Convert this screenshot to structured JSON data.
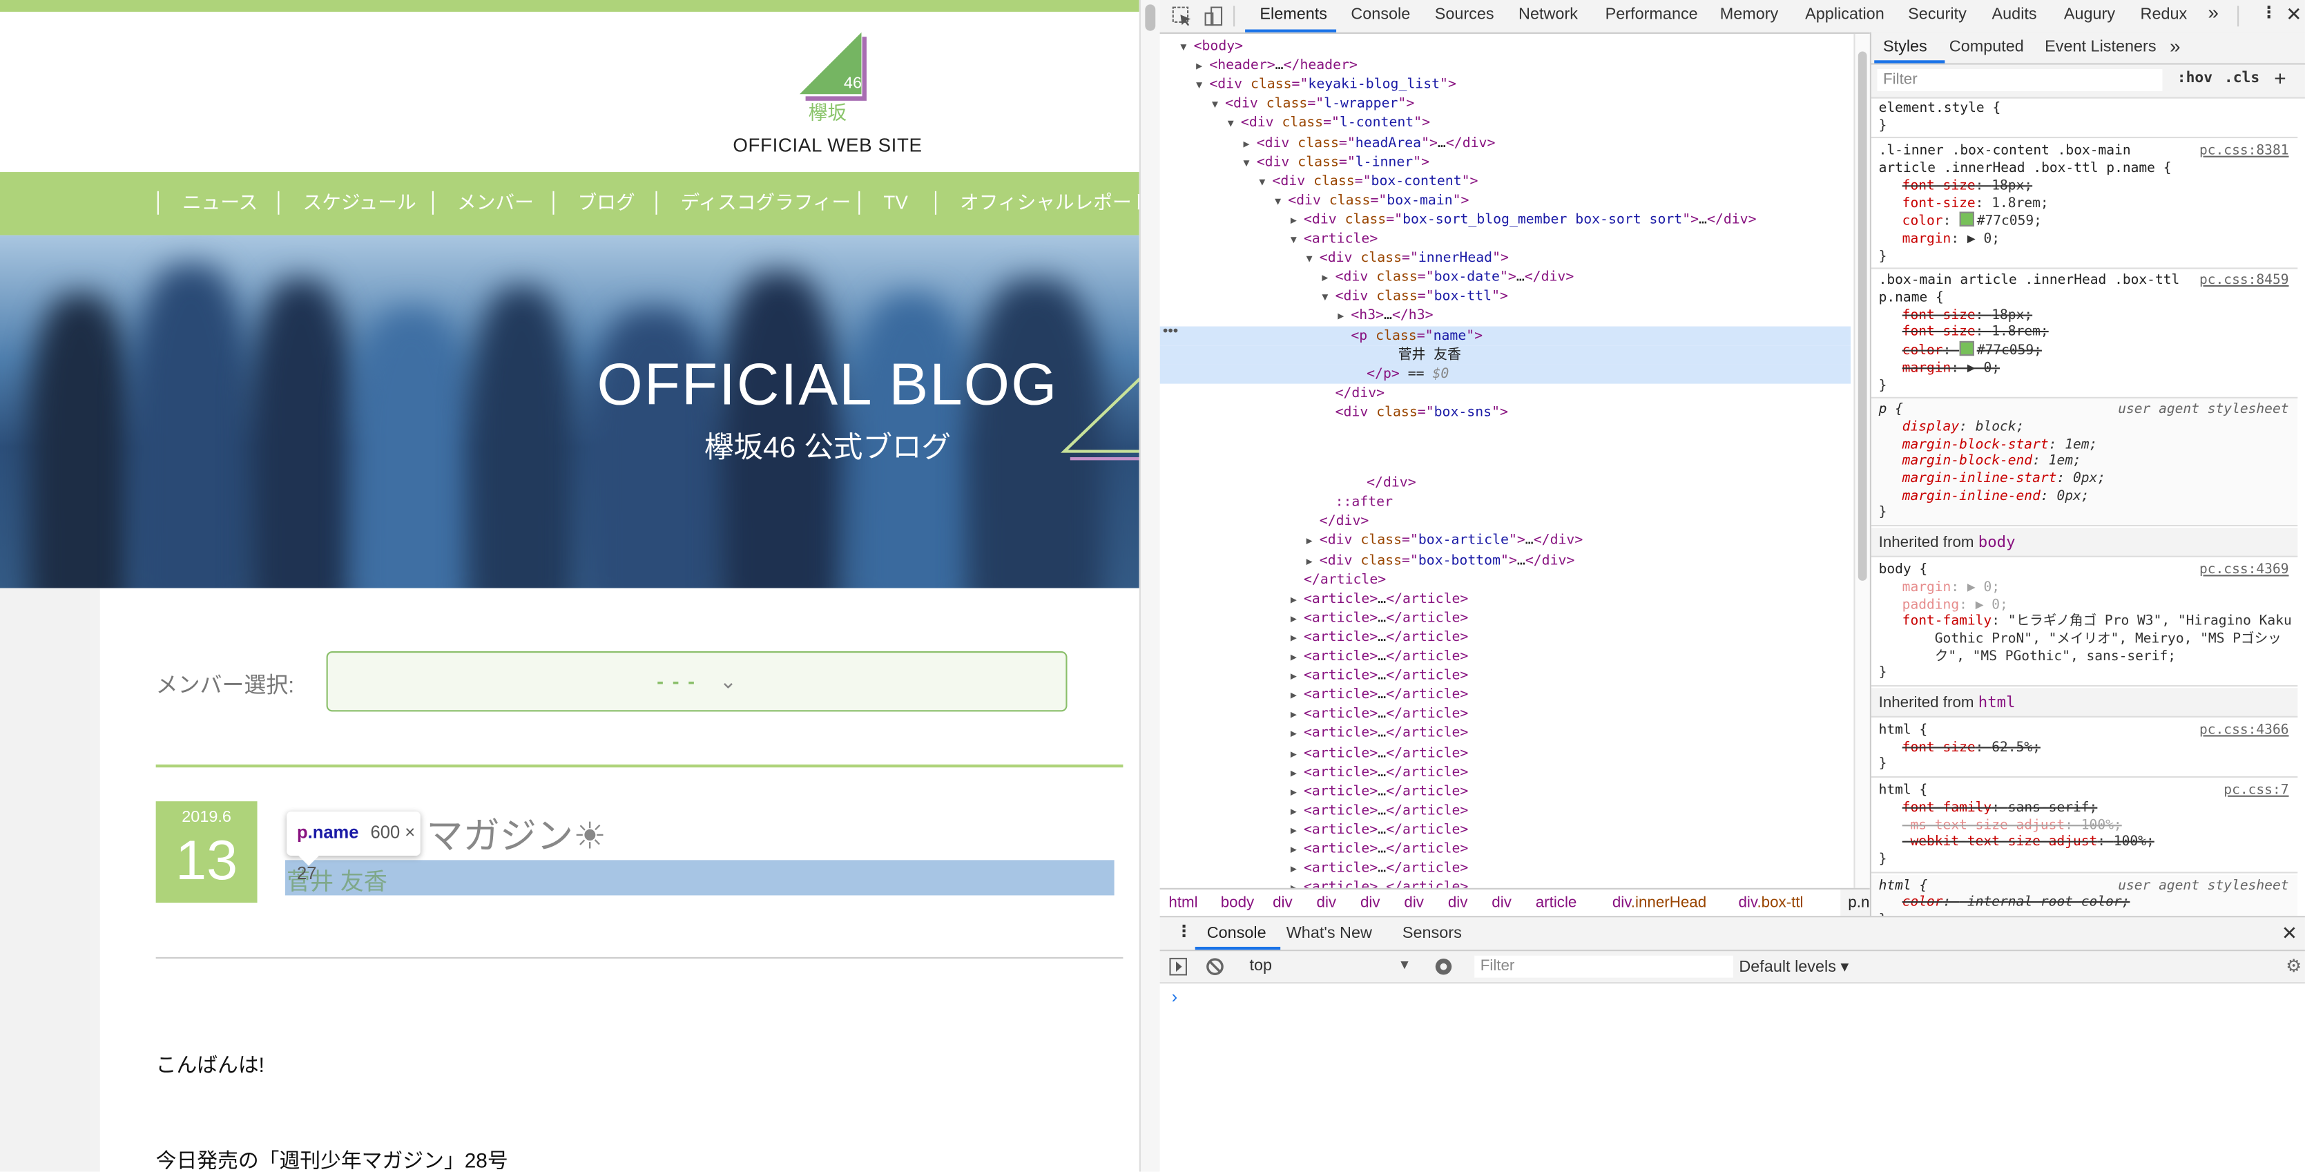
{
  "page": {
    "logo": {
      "number": "46",
      "name": "欅坂"
    },
    "site_title": "OFFICIAL WEB SITE",
    "nav": [
      "ニュース",
      "スケジュール",
      "メンバー",
      "ブログ",
      "ディスコグラフィー",
      "TV",
      "オフィシャルレポート"
    ],
    "hero": {
      "title": "OFFICIAL BLOG",
      "subtitle": "欅坂46 公式ブログ"
    },
    "member_select": {
      "label": "メンバー選択:",
      "value": "- - -",
      "chevron": "⌄"
    },
    "post": {
      "date_ym": "2019.6",
      "date_d": "13",
      "title_visible": "マガジン☀",
      "author": "菅井 友香",
      "body": [
        "こんばんは!",
        "今日発売の「週刊少年マガジン」28号"
      ]
    },
    "inspect_tooltip": {
      "tag": "p",
      "class": ".name",
      "size": "600 × 27"
    },
    "colors": {
      "accent_green": "#aed37a",
      "name_color": "#77c059",
      "highlight": "#a7c5e4"
    }
  },
  "devtools": {
    "tabs": [
      "Elements",
      "Console",
      "Sources",
      "Network",
      "Performance",
      "Memory",
      "Application",
      "Security",
      "Audits",
      "Augury",
      "Redux"
    ],
    "active_tab": "Elements",
    "more": "»",
    "dom": [
      {
        "i": 0,
        "a": "d",
        "k": [
          [
            "tag",
            "<body>"
          ]
        ]
      },
      {
        "i": 1,
        "a": "r",
        "k": [
          [
            "tag",
            "<header>"
          ],
          [
            "text",
            "…"
          ],
          [
            "tag",
            "</header>"
          ]
        ]
      },
      {
        "i": 1,
        "a": "d",
        "k": [
          [
            "tag",
            "<div "
          ],
          [
            "attr",
            "class"
          ],
          [
            "tag",
            "=\""
          ],
          [
            "val",
            "keyaki-blog_list"
          ],
          [
            "tag",
            "\">"
          ]
        ]
      },
      {
        "i": 2,
        "a": "d",
        "k": [
          [
            "tag",
            "<div "
          ],
          [
            "attr",
            "class"
          ],
          [
            "tag",
            "=\""
          ],
          [
            "val",
            "l-wrapper"
          ],
          [
            "tag",
            "\">"
          ]
        ]
      },
      {
        "i": 3,
        "a": "d",
        "k": [
          [
            "tag",
            "<div "
          ],
          [
            "attr",
            "class"
          ],
          [
            "tag",
            "=\""
          ],
          [
            "val",
            "l-content"
          ],
          [
            "tag",
            "\">"
          ]
        ]
      },
      {
        "i": 4,
        "a": "r",
        "k": [
          [
            "tag",
            "<div "
          ],
          [
            "attr",
            "class"
          ],
          [
            "tag",
            "=\""
          ],
          [
            "val",
            "headArea"
          ],
          [
            "tag",
            "\">"
          ],
          [
            "text",
            "…"
          ],
          [
            "tag",
            "</div>"
          ]
        ]
      },
      {
        "i": 4,
        "a": "d",
        "k": [
          [
            "tag",
            "<div "
          ],
          [
            "attr",
            "class"
          ],
          [
            "tag",
            "=\""
          ],
          [
            "val",
            "l-inner"
          ],
          [
            "tag",
            "\">"
          ]
        ]
      },
      {
        "i": 5,
        "a": "d",
        "k": [
          [
            "tag",
            "<div "
          ],
          [
            "attr",
            "class"
          ],
          [
            "tag",
            "=\""
          ],
          [
            "val",
            "box-content"
          ],
          [
            "tag",
            "\">"
          ]
        ]
      },
      {
        "i": 6,
        "a": "d",
        "k": [
          [
            "tag",
            "<div "
          ],
          [
            "attr",
            "class"
          ],
          [
            "tag",
            "=\""
          ],
          [
            "val",
            "box-main"
          ],
          [
            "tag",
            "\">"
          ]
        ]
      },
      {
        "i": 7,
        "a": "r",
        "k": [
          [
            "tag",
            "<div "
          ],
          [
            "attr",
            "class"
          ],
          [
            "tag",
            "=\""
          ],
          [
            "val",
            "box-sort_blog_member box-sort sort"
          ],
          [
            "tag",
            "\">"
          ],
          [
            "text",
            "…"
          ],
          [
            "tag",
            "</div>"
          ]
        ]
      },
      {
        "i": 7,
        "a": "d",
        "k": [
          [
            "tag",
            "<article>"
          ]
        ]
      },
      {
        "i": 8,
        "a": "d",
        "k": [
          [
            "tag",
            "<div "
          ],
          [
            "attr",
            "class"
          ],
          [
            "tag",
            "=\""
          ],
          [
            "val",
            "innerHead"
          ],
          [
            "tag",
            "\">"
          ]
        ]
      },
      {
        "i": 9,
        "a": "r",
        "k": [
          [
            "tag",
            "<div "
          ],
          [
            "attr",
            "class"
          ],
          [
            "tag",
            "=\""
          ],
          [
            "val",
            "box-date"
          ],
          [
            "tag",
            "\">"
          ],
          [
            "text",
            "…"
          ],
          [
            "tag",
            "</div>"
          ]
        ]
      },
      {
        "i": 9,
        "a": "d",
        "k": [
          [
            "tag",
            "<div "
          ],
          [
            "attr",
            "class"
          ],
          [
            "tag",
            "=\""
          ],
          [
            "val",
            "box-ttl"
          ],
          [
            "tag",
            "\">"
          ]
        ]
      },
      {
        "i": 10,
        "a": "r",
        "k": [
          [
            "tag",
            "<h3>"
          ],
          [
            "text",
            "…"
          ],
          [
            "tag",
            "</h3>"
          ]
        ]
      },
      {
        "i": 10,
        "a": "",
        "s": true,
        "k": [
          [
            "tag",
            "<p "
          ],
          [
            "attr",
            "class"
          ],
          [
            "tag",
            "=\""
          ],
          [
            "val",
            "name"
          ],
          [
            "tag",
            "\">"
          ]
        ]
      },
      {
        "i": 13,
        "a": "",
        "s": true,
        "k": [
          [
            "text",
            "菅井 友香"
          ]
        ]
      },
      {
        "i": 11,
        "a": "",
        "s": true,
        "k": [
          [
            "tag",
            "</p>"
          ],
          [
            "text",
            " == "
          ],
          [
            "dim",
            "$0"
          ]
        ]
      },
      {
        "i": 9,
        "a": "",
        "k": [
          [
            "tag",
            "</div>"
          ]
        ]
      },
      {
        "i": 9,
        "a": "",
        "k": [
          [
            "tag",
            "<div "
          ],
          [
            "attr",
            "class"
          ],
          [
            "tag",
            "=\""
          ],
          [
            "val",
            "box-sns"
          ],
          [
            "tag",
            "\">"
          ]
        ]
      },
      {
        "i": 9,
        "a": "",
        "k": []
      },
      {
        "i": 9,
        "a": "",
        "k": []
      },
      {
        "i": 11,
        "a": "",
        "k": [
          [
            "tag",
            "</div>"
          ]
        ]
      },
      {
        "i": 9,
        "a": "",
        "k": [
          [
            "tag",
            "::after"
          ]
        ]
      },
      {
        "i": 8,
        "a": "",
        "k": [
          [
            "tag",
            "</div>"
          ]
        ]
      },
      {
        "i": 8,
        "a": "r",
        "k": [
          [
            "tag",
            "<div "
          ],
          [
            "attr",
            "class"
          ],
          [
            "tag",
            "=\""
          ],
          [
            "val",
            "box-article"
          ],
          [
            "tag",
            "\">"
          ],
          [
            "text",
            "…"
          ],
          [
            "tag",
            "</div>"
          ]
        ]
      },
      {
        "i": 8,
        "a": "r",
        "k": [
          [
            "tag",
            "<div "
          ],
          [
            "attr",
            "class"
          ],
          [
            "tag",
            "=\""
          ],
          [
            "val",
            "box-bottom"
          ],
          [
            "tag",
            "\">"
          ],
          [
            "text",
            "…"
          ],
          [
            "tag",
            "</div>"
          ]
        ]
      },
      {
        "i": 7,
        "a": "",
        "k": [
          [
            "tag",
            "</article>"
          ]
        ]
      }
    ],
    "collapsed_article": {
      "count": 16,
      "k": [
        [
          "tag",
          "<article>"
        ],
        [
          "text",
          "…"
        ],
        [
          "tag",
          "</article>"
        ]
      ]
    },
    "breadcrumbs": [
      {
        "tag": "html"
      },
      {
        "tag": "body"
      },
      {
        "tag": "div"
      },
      {
        "tag": "div"
      },
      {
        "tag": "div"
      },
      {
        "tag": "div"
      },
      {
        "tag": "div"
      },
      {
        "tag": "div"
      },
      {
        "tag": "article"
      },
      {
        "tag": "div",
        "cls": ".innerHead"
      },
      {
        "tag": "div",
        "cls": ".box-ttl"
      },
      {
        "tag": "p.name",
        "current": true
      }
    ],
    "styles": {
      "tabs": [
        "Styles",
        "Computed",
        "Event Listeners",
        "»"
      ],
      "filter_placeholder": "Filter",
      "hov": ":hov",
      "cls": ".cls",
      "add": "+",
      "rules": [
        {
          "sel": [
            "element.style {"
          ],
          "src": "",
          "props": []
        },
        {
          "sel": [
            ".l-inner .box-content .box-main",
            "article .innerHead .box-ttl p.name {"
          ],
          "src": "pc.css:8381",
          "props": [
            {
              "n": "font-size",
              "v": "18px;",
              "strike": true
            },
            {
              "n": "font-size",
              "v": "1.8rem;"
            },
            {
              "n": "color",
              "v": "#77c059;",
              "swatch": true
            },
            {
              "n": "margin",
              "v": "▶ 0;"
            }
          ]
        },
        {
          "sel": [
            ".box-main article .innerHead .box-ttl",
            "p.name {"
          ],
          "src": "pc.css:8459",
          "props": [
            {
              "n": "font-size",
              "v": "18px;",
              "strike": true
            },
            {
              "n": "font-size",
              "v": "1.8rem;",
              "strike": true
            },
            {
              "n": "color",
              "v": "#77c059;",
              "swatch": true,
              "strike": true
            },
            {
              "n": "margin",
              "v": "▶ 0;",
              "strike": true
            }
          ]
        },
        {
          "sel": [
            "p {"
          ],
          "src": "user agent stylesheet",
          "ua": true,
          "props": [
            {
              "n": "display",
              "v": "block;",
              "ital": true
            },
            {
              "n": "margin-block-start",
              "v": "1em;",
              "ital": true
            },
            {
              "n": "margin-block-end",
              "v": "1em;",
              "ital": true
            },
            {
              "n": "margin-inline-start",
              "v": "0px;",
              "ital": true
            },
            {
              "n": "margin-inline-end",
              "v": "0px;",
              "ital": true
            }
          ]
        },
        {
          "inherited": "body",
          "label": "Inherited from"
        },
        {
          "sel": [
            "body {"
          ],
          "src": "pc.css:4369",
          "props": [
            {
              "n": "margin",
              "v": "▶ 0;",
              "dim": true
            },
            {
              "n": "padding",
              "v": "▶ 0;",
              "dim": true
            },
            {
              "n": "font-family",
              "v": "\"ヒラギノ角ゴ Pro W3\", \"Hiragino Kaku\n    Gothic ProN\", \"メイリオ\", Meiryo, \"MS Pゴシッ\n    ク\", \"MS PGothic\", sans-serif;"
            }
          ]
        },
        {
          "inherited": "html",
          "label": "Inherited from"
        },
        {
          "sel": [
            "html {"
          ],
          "src": "pc.css:4366",
          "props": [
            {
              "n": "font-size",
              "v": "62.5%;",
              "strike": true
            }
          ]
        },
        {
          "sel": [
            "html {"
          ],
          "src": "pc.css:7",
          "props": [
            {
              "n": "font-family",
              "v": "sans-serif;",
              "strike": true
            },
            {
              "n": "-ms-text-size-adjust",
              "v": "100%;",
              "strike": true,
              "dim": true
            },
            {
              "n": "-webkit-text-size-adjust",
              "v": "100%;",
              "strike": true
            }
          ]
        },
        {
          "sel": [
            "html {"
          ],
          "src": "user agent stylesheet",
          "ua": true,
          "props": [
            {
              "n": "color",
              "v": "-internal-root-color;",
              "strike": true,
              "ital": true
            }
          ]
        }
      ]
    },
    "drawer": {
      "tabs": [
        "Console",
        "What's New",
        "Sensors"
      ],
      "active": "Console",
      "context": "top",
      "filter_placeholder": "Filter",
      "levels": "Default levels ▾",
      "prompt": "›"
    }
  }
}
